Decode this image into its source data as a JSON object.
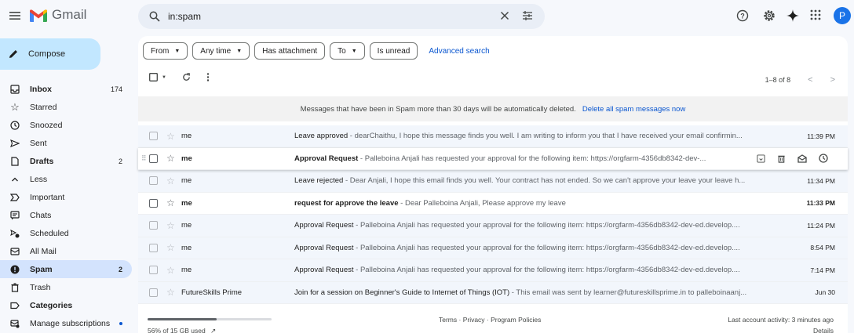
{
  "app": {
    "name": "Gmail",
    "avatar_letter": "P"
  },
  "search": {
    "value": "in:spam"
  },
  "compose_label": "Compose",
  "sidebar": {
    "items": [
      {
        "label": "Inbox",
        "count": "174",
        "icon": "inbox-icon",
        "bold": true
      },
      {
        "label": "Starred",
        "icon": "star-icon"
      },
      {
        "label": "Snoozed",
        "icon": "clock-icon"
      },
      {
        "label": "Sent",
        "icon": "send-icon"
      },
      {
        "label": "Drafts",
        "count": "2",
        "icon": "draft-icon",
        "bold": true
      },
      {
        "label": "Less",
        "icon": "chevron-up-icon"
      },
      {
        "label": "Important",
        "icon": "important-icon"
      },
      {
        "label": "Chats",
        "icon": "chat-icon"
      },
      {
        "label": "Scheduled",
        "icon": "scheduled-icon"
      },
      {
        "label": "All Mail",
        "icon": "all-mail-icon"
      },
      {
        "label": "Spam",
        "count": "2",
        "icon": "spam-icon",
        "active": true
      },
      {
        "label": "Trash",
        "icon": "trash-icon"
      },
      {
        "label": "Categories",
        "icon": "label-icon",
        "bold": true
      },
      {
        "label": "Manage subscriptions",
        "icon": "subscriptions-icon"
      }
    ]
  },
  "filters": [
    "From",
    "Any time",
    "Has attachment",
    "To",
    "Is unread"
  ],
  "advanced_search": "Advanced search",
  "pager": {
    "range": "1–8 of 8"
  },
  "notice": {
    "text": "Messages that have been in Spam more than 30 days will be automatically deleted.",
    "action": "Delete all spam messages now"
  },
  "emails": [
    {
      "from": "me",
      "subject": "Leave approved",
      "snippet": " - dearChaithu, I hope this message finds you well. I am writing to inform you that I have received your email confirmin...",
      "time": "11:39 PM",
      "unread": false
    },
    {
      "from": "me",
      "subject": "Approval Request",
      "snippet": " - Palleboina Anjali has requested your approval for the following item: https://orgfarm-4356db8342-dev-...",
      "time": "",
      "unread": true,
      "hover": true
    },
    {
      "from": "me",
      "subject": "Leave rejected",
      "snippet": " - Dear Anjali, I hope this email finds you well. Your contract has not ended. So we can't approve your leave your leave h...",
      "time": "11:34 PM",
      "unread": false
    },
    {
      "from": "me",
      "subject": "request for approve the leave",
      "snippet": " - Dear Palleboina Anjali, Please approve my leave",
      "time": "11:33 PM",
      "unread": true
    },
    {
      "from": "me",
      "subject": "Approval Request",
      "snippet": " - Palleboina Anjali has requested your approval for the following item: https://orgfarm-4356db8342-dev-ed.develop....",
      "time": "11:24 PM",
      "unread": false
    },
    {
      "from": "me",
      "subject": "Approval Request",
      "snippet": " - Palleboina Anjali has requested your approval for the following item: https://orgfarm-4356db8342-dev-ed.develop....",
      "time": "8:54 PM",
      "unread": false
    },
    {
      "from": "me",
      "subject": "Approval Request",
      "snippet": " - Palleboina Anjali has requested your approval for the following item: https://orgfarm-4356db8342-dev-ed.develop....",
      "time": "7:14 PM",
      "unread": false
    },
    {
      "from": "FutureSkills Prime",
      "subject": "Join for a session on Beginner's Guide to Internet of Things (IOT)",
      "snippet": " - This email was sent by learner@futureskillsprime.in to palleboinaanj...",
      "time": "Jun 30",
      "unread": false
    }
  ],
  "footer": {
    "storage": "56% of 15 GB used",
    "storage_fraction": 0.56,
    "terms": "Terms · Privacy · Program Policies",
    "activity": "Last account activity: 3 minutes ago",
    "details": "Details"
  },
  "colors": {
    "accent": "#0b57d0",
    "compose_bg": "#c2e7ff",
    "active_nav": "#d3e3fd"
  }
}
